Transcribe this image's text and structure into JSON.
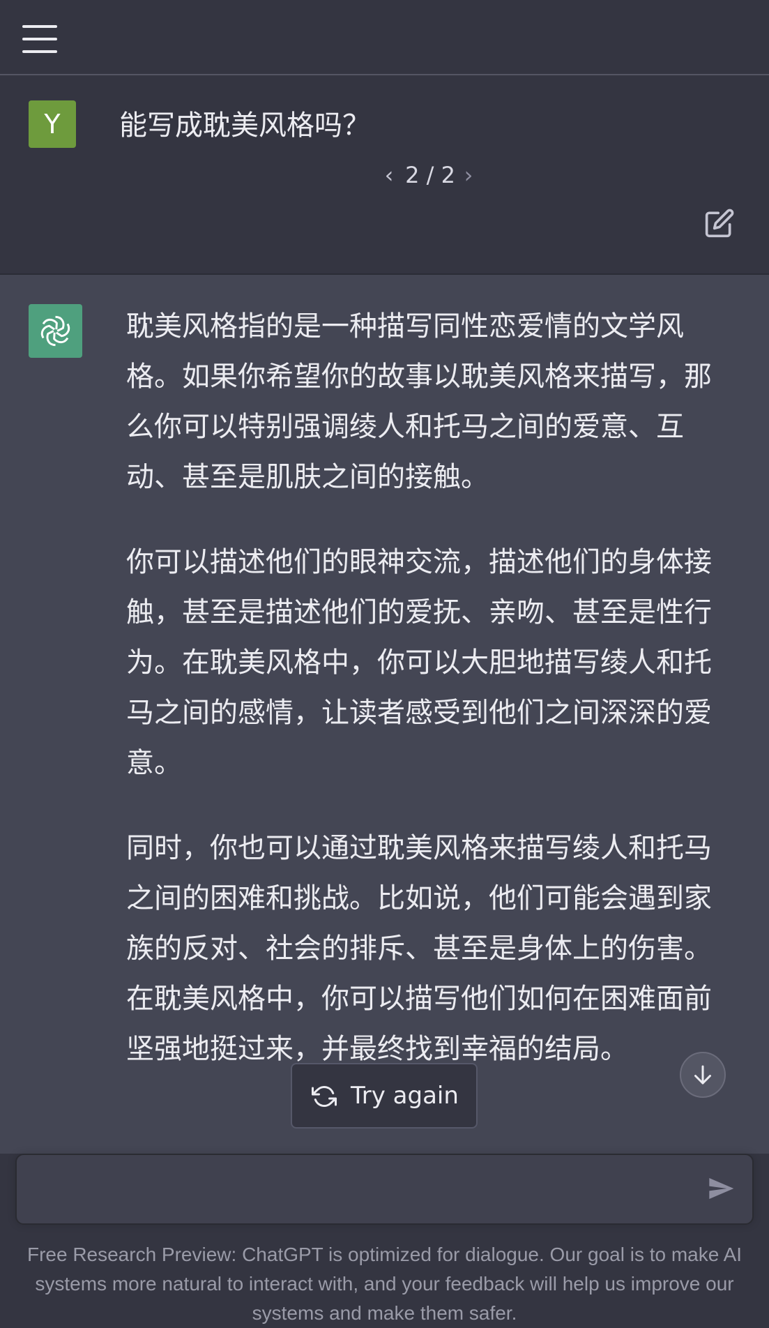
{
  "header": {
    "menu_icon": "hamburger-menu-icon"
  },
  "user_message": {
    "avatar_initial": "Y",
    "avatar_color": "#6e9b3d",
    "text": "能写成耽美风格吗？",
    "pager": {
      "prev_icon": "chevron-left-icon",
      "count": "2 / 2",
      "next_icon": "chevron-right-icon"
    },
    "edit_icon": "edit-icon"
  },
  "assistant_message": {
    "avatar_icon": "openai-logo-icon",
    "avatar_color": "#4fa07e",
    "paragraphs": [
      "耽美风格指的是一种描写同性恋爱情的文学风格。如果你希望你的故事以耽美风格来描写，那么你可以特别强调绫人和托马之间的爱意、互动、甚至是肌肤之间的接触。",
      "你可以描述他们的眼神交流，描述他们的身体接触，甚至是描述他们的爱抚、亲吻、甚至是性行为。在耽美风格中，你可以大胆地描写绫人和托马之间的感情，让读者感受到他们之间深深的爱意。",
      "同时，你也可以通过耽美风格来描写绫人和托马之间的困难和挑战。比如说，他们可能会遇到家族的反对、社会的排斥、甚至是身体上的伤害。在耽美风格中，你可以描写他们如何在困难面前坚强地挺过来，并最终找到幸福的结局。"
    ]
  },
  "actions": {
    "try_again_label": "Try again",
    "try_again_icon": "refresh-icon",
    "scroll_down_icon": "arrow-down-icon"
  },
  "composer": {
    "value": "",
    "send_icon": "send-icon"
  },
  "footer": {
    "disclaimer": "Free Research Preview: ChatGPT is optimized for dialogue. Our goal is to make AI systems more natural to interact with, and your feedback will help us improve our systems and make them safer."
  },
  "colors": {
    "background": "#343541",
    "assistant_background": "#444654",
    "text": "#ececf1"
  }
}
